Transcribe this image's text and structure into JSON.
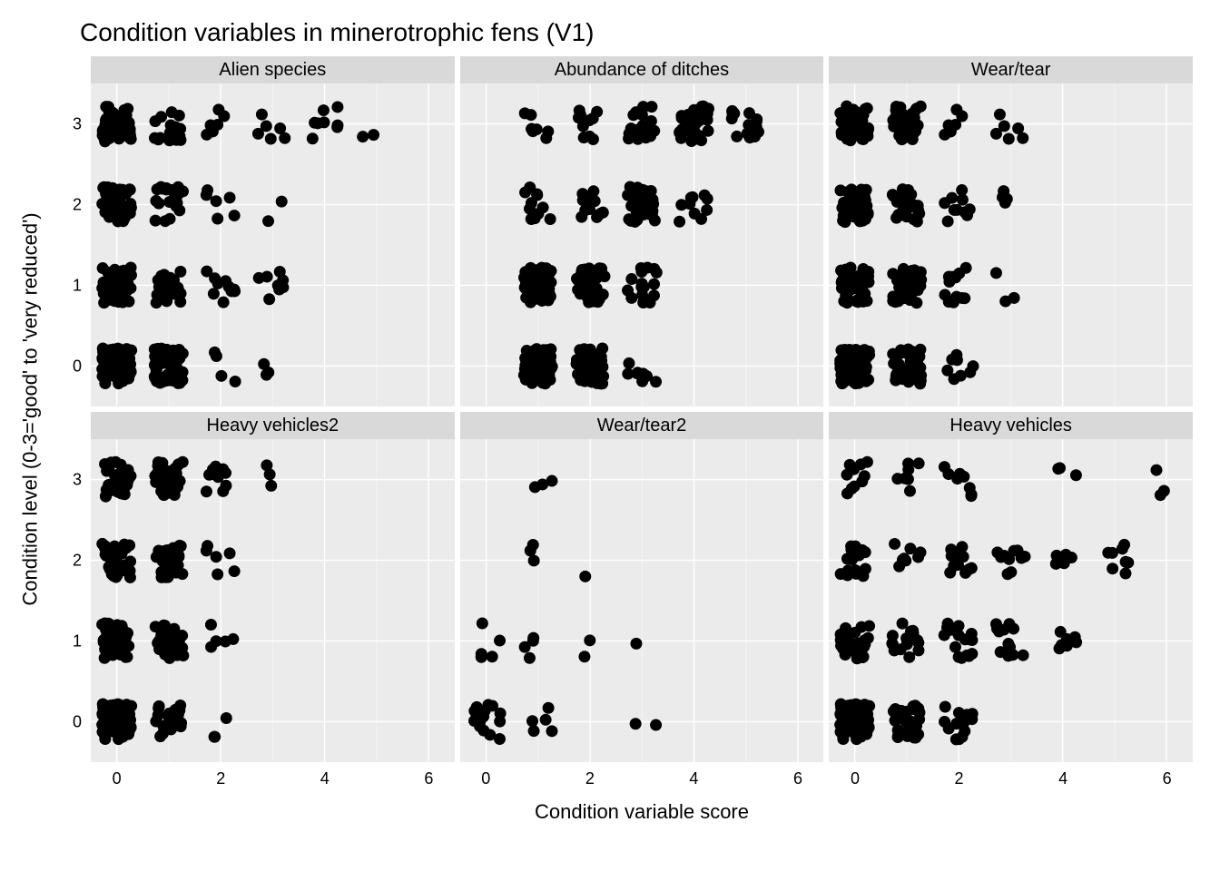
{
  "chart_data": {
    "type": "scatter",
    "title": "Condition variables in minerotrophic fens (V1)",
    "xlabel": "Condition variable score",
    "ylabel": "Condition level (0-3='good' to 'very reduced')",
    "xlim": [
      -0.5,
      6.5
    ],
    "ylim": [
      -0.5,
      3.5
    ],
    "x_ticks": [
      0,
      2,
      4,
      6
    ],
    "y_ticks": [
      0,
      1,
      2,
      3
    ],
    "jitter": {
      "x": 0.28,
      "y": 0.22
    },
    "point_radius": 6.5,
    "facets": [
      {
        "name": "Alien species",
        "clusters": [
          {
            "x": 0,
            "y": 0,
            "n": 90
          },
          {
            "x": 1,
            "y": 0,
            "n": 50
          },
          {
            "x": 2,
            "y": 0,
            "n": 4
          },
          {
            "x": 3,
            "y": 0,
            "n": 3
          },
          {
            "x": 0,
            "y": 1,
            "n": 60
          },
          {
            "x": 1,
            "y": 1,
            "n": 25
          },
          {
            "x": 2,
            "y": 1,
            "n": 10
          },
          {
            "x": 3,
            "y": 1,
            "n": 8
          },
          {
            "x": 0,
            "y": 2,
            "n": 55
          },
          {
            "x": 1,
            "y": 2,
            "n": 22
          },
          {
            "x": 2,
            "y": 2,
            "n": 6
          },
          {
            "x": 3,
            "y": 2,
            "n": 2
          },
          {
            "x": 0,
            "y": 3,
            "n": 50
          },
          {
            "x": 1,
            "y": 3,
            "n": 18
          },
          {
            "x": 2,
            "y": 3,
            "n": 6
          },
          {
            "x": 3,
            "y": 3,
            "n": 6
          },
          {
            "x": 4,
            "y": 3,
            "n": 8
          },
          {
            "x": 5,
            "y": 3,
            "n": 2
          }
        ]
      },
      {
        "name": "Abundance of ditches",
        "clusters": [
          {
            "x": 1,
            "y": 0,
            "n": 80
          },
          {
            "x": 2,
            "y": 0,
            "n": 50
          },
          {
            "x": 3,
            "y": 0,
            "n": 8
          },
          {
            "x": 1,
            "y": 1,
            "n": 55
          },
          {
            "x": 2,
            "y": 1,
            "n": 45
          },
          {
            "x": 3,
            "y": 1,
            "n": 18
          },
          {
            "x": 1,
            "y": 2,
            "n": 12
          },
          {
            "x": 2,
            "y": 2,
            "n": 14
          },
          {
            "x": 3,
            "y": 2,
            "n": 40
          },
          {
            "x": 4,
            "y": 2,
            "n": 10
          },
          {
            "x": 1,
            "y": 3,
            "n": 8
          },
          {
            "x": 2,
            "y": 3,
            "n": 10
          },
          {
            "x": 3,
            "y": 3,
            "n": 20
          },
          {
            "x": 4,
            "y": 3,
            "n": 35
          },
          {
            "x": 5,
            "y": 3,
            "n": 20
          }
        ]
      },
      {
        "name": "Wear/tear",
        "clusters": [
          {
            "x": 0,
            "y": 0,
            "n": 80
          },
          {
            "x": 1,
            "y": 0,
            "n": 55
          },
          {
            "x": 2,
            "y": 0,
            "n": 8
          },
          {
            "x": 0,
            "y": 1,
            "n": 55
          },
          {
            "x": 1,
            "y": 1,
            "n": 40
          },
          {
            "x": 2,
            "y": 1,
            "n": 12
          },
          {
            "x": 3,
            "y": 1,
            "n": 3
          },
          {
            "x": 0,
            "y": 2,
            "n": 50
          },
          {
            "x": 1,
            "y": 2,
            "n": 28
          },
          {
            "x": 2,
            "y": 2,
            "n": 10
          },
          {
            "x": 3,
            "y": 2,
            "n": 4
          },
          {
            "x": 0,
            "y": 3,
            "n": 45
          },
          {
            "x": 1,
            "y": 3,
            "n": 30
          },
          {
            "x": 2,
            "y": 3,
            "n": 6
          },
          {
            "x": 3,
            "y": 3,
            "n": 6
          }
        ]
      },
      {
        "name": "Heavy vehicles2",
        "clusters": [
          {
            "x": 0,
            "y": 0,
            "n": 90
          },
          {
            "x": 1,
            "y": 0,
            "n": 22
          },
          {
            "x": 2,
            "y": 0,
            "n": 3
          },
          {
            "x": 0,
            "y": 1,
            "n": 45
          },
          {
            "x": 1,
            "y": 1,
            "n": 35
          },
          {
            "x": 2,
            "y": 1,
            "n": 5
          },
          {
            "x": 0,
            "y": 2,
            "n": 40
          },
          {
            "x": 1,
            "y": 2,
            "n": 30
          },
          {
            "x": 2,
            "y": 2,
            "n": 6
          },
          {
            "x": 0,
            "y": 3,
            "n": 35
          },
          {
            "x": 1,
            "y": 3,
            "n": 30
          },
          {
            "x": 2,
            "y": 3,
            "n": 12
          },
          {
            "x": 3,
            "y": 3,
            "n": 3
          }
        ]
      },
      {
        "name": "Wear/tear2",
        "clusters": [
          {
            "x": 0,
            "y": 0,
            "n": 14
          },
          {
            "x": 1,
            "y": 0,
            "n": 5
          },
          {
            "x": 3,
            "y": 0,
            "n": 2
          },
          {
            "x": 0,
            "y": 1,
            "n": 5
          },
          {
            "x": 1,
            "y": 1,
            "n": 4
          },
          {
            "x": 2,
            "y": 1,
            "n": 2
          },
          {
            "x": 3,
            "y": 1,
            "n": 1
          },
          {
            "x": 1,
            "y": 2,
            "n": 3
          },
          {
            "x": 2,
            "y": 2,
            "n": 1
          },
          {
            "x": 1,
            "y": 3,
            "n": 3
          }
        ]
      },
      {
        "name": "Heavy vehicles",
        "clusters": [
          {
            "x": 0,
            "y": 0,
            "n": 90
          },
          {
            "x": 1,
            "y": 0,
            "n": 40
          },
          {
            "x": 2,
            "y": 0,
            "n": 14
          },
          {
            "x": 0,
            "y": 1,
            "n": 30
          },
          {
            "x": 1,
            "y": 1,
            "n": 20
          },
          {
            "x": 2,
            "y": 1,
            "n": 18
          },
          {
            "x": 3,
            "y": 1,
            "n": 14
          },
          {
            "x": 4,
            "y": 1,
            "n": 8
          },
          {
            "x": 0,
            "y": 2,
            "n": 16
          },
          {
            "x": 1,
            "y": 2,
            "n": 8
          },
          {
            "x": 2,
            "y": 2,
            "n": 14
          },
          {
            "x": 3,
            "y": 2,
            "n": 10
          },
          {
            "x": 4,
            "y": 2,
            "n": 6
          },
          {
            "x": 5,
            "y": 2,
            "n": 8
          },
          {
            "x": 0,
            "y": 3,
            "n": 10
          },
          {
            "x": 1,
            "y": 3,
            "n": 7
          },
          {
            "x": 2,
            "y": 3,
            "n": 8
          },
          {
            "x": 4,
            "y": 3,
            "n": 3
          },
          {
            "x": 6,
            "y": 3,
            "n": 3
          }
        ]
      }
    ]
  }
}
